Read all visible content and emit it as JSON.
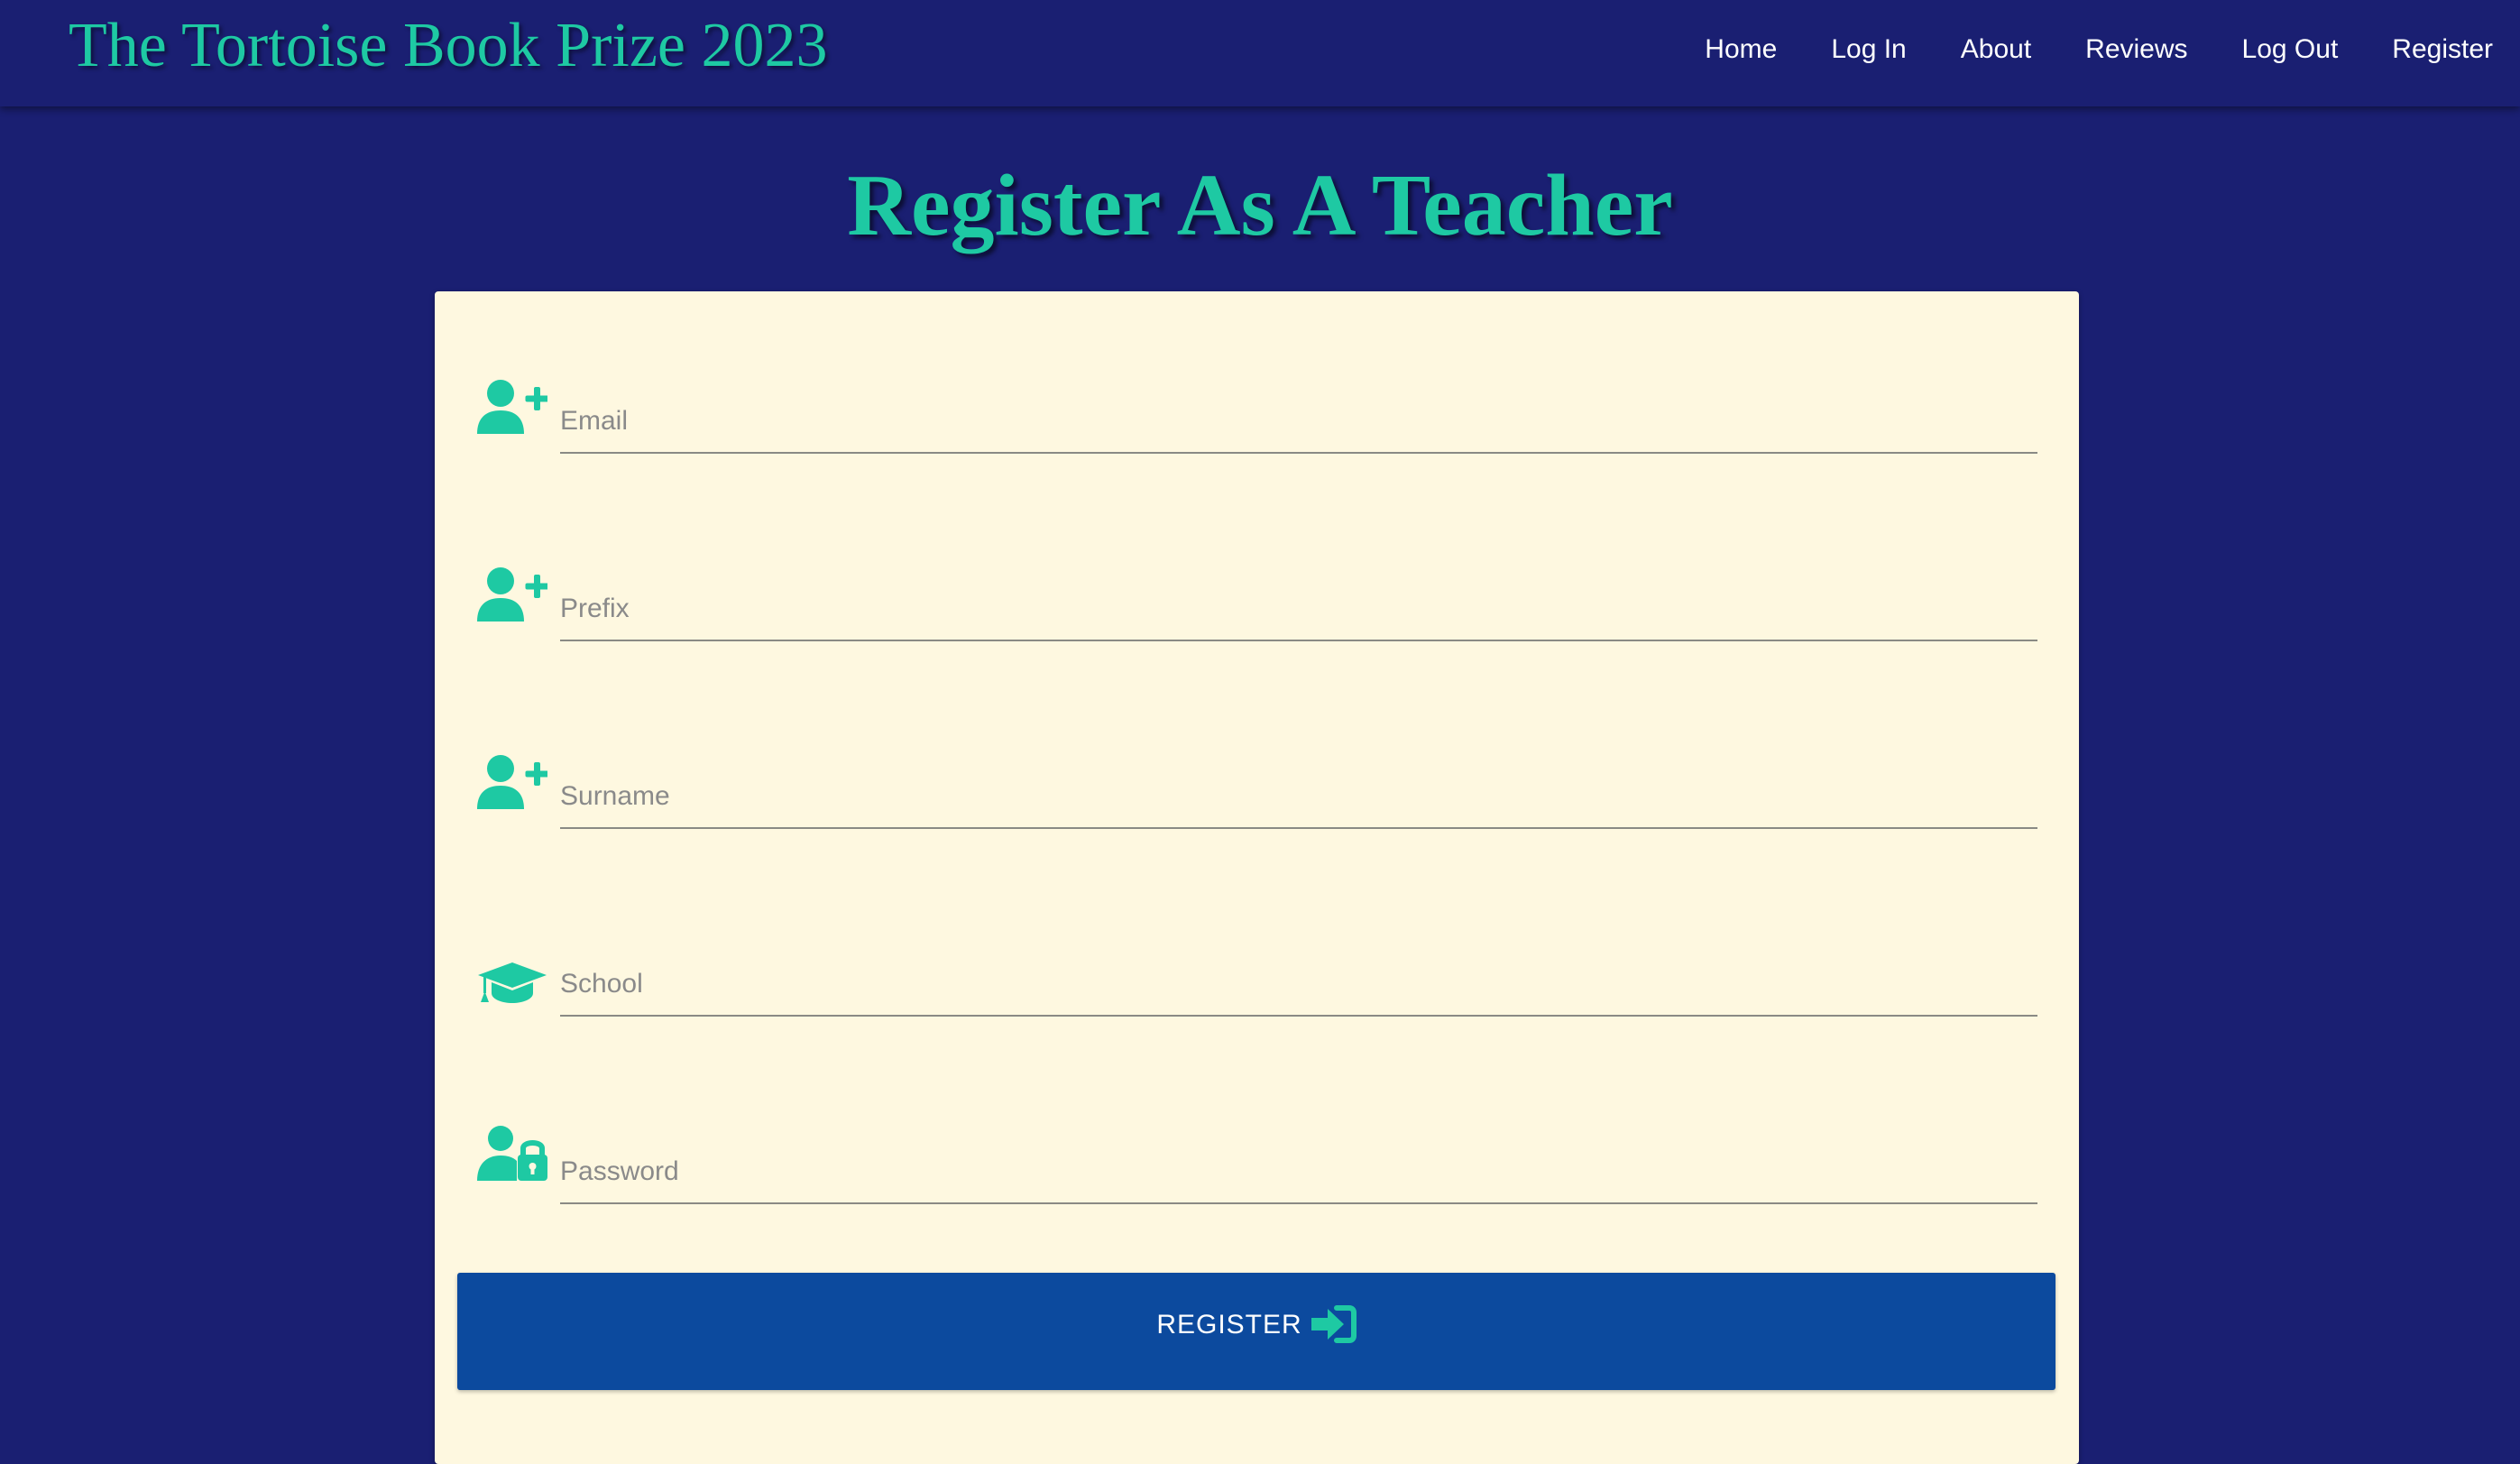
{
  "header": {
    "brand": "The Tortoise Book Prize 2023",
    "nav": [
      {
        "label": "Home"
      },
      {
        "label": "Log In"
      },
      {
        "label": "About"
      },
      {
        "label": "Reviews"
      },
      {
        "label": "Log Out"
      },
      {
        "label": "Register"
      }
    ]
  },
  "page": {
    "title": "Register As A Teacher"
  },
  "form": {
    "fields": [
      {
        "placeholder": "Email",
        "value": "",
        "icon": "user-plus-icon"
      },
      {
        "placeholder": "Prefix",
        "value": "",
        "icon": "user-plus-icon"
      },
      {
        "placeholder": "Surname",
        "value": "",
        "icon": "user-plus-icon"
      },
      {
        "placeholder": "School",
        "value": "",
        "icon": "graduation-cap-icon"
      },
      {
        "placeholder": "Password",
        "value": "",
        "icon": "user-lock-icon"
      }
    ],
    "submit_label": "REGISTER",
    "submit_icon": "sign-in-icon"
  },
  "colors": {
    "background": "#1a1f72",
    "accent": "#1ec9a3",
    "card": "#fef8e0",
    "button": "#0c4a9e"
  }
}
